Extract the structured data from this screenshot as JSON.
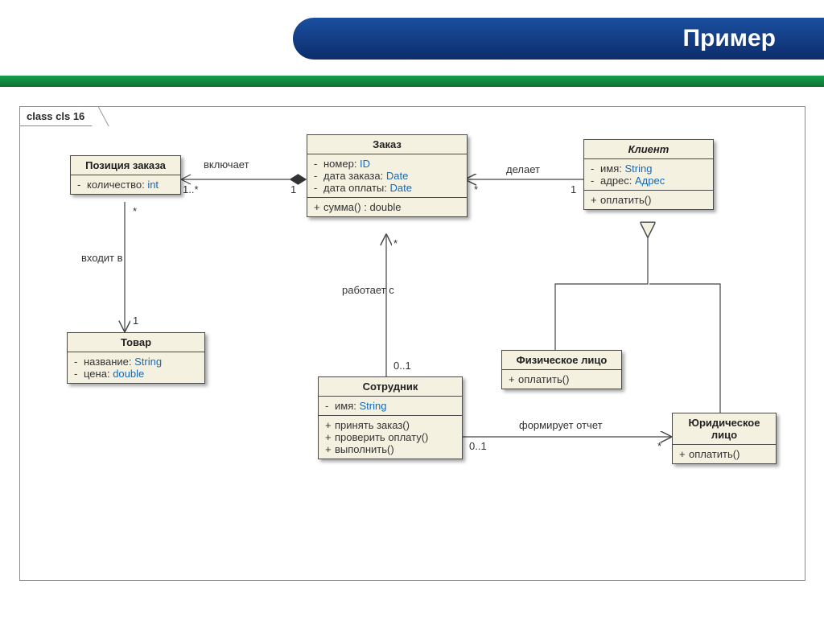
{
  "slide": {
    "title": "Пример"
  },
  "frame": {
    "label": "class cls 16"
  },
  "classes": {
    "orderItem": {
      "name": "Позиция заказа",
      "attrs": [
        {
          "vis": "-",
          "name": "количество",
          "type": "int"
        }
      ]
    },
    "order": {
      "name": "Заказ",
      "attrs": [
        {
          "vis": "-",
          "name": "номер",
          "type": "ID"
        },
        {
          "vis": "-",
          "name": "дата заказа",
          "type": "Date"
        },
        {
          "vis": "-",
          "name": "дата оплаты",
          "type": "Date"
        }
      ],
      "ops": [
        {
          "vis": "+",
          "sig": "сумма() : double"
        }
      ]
    },
    "client": {
      "name": "Клиент",
      "nameItalic": true,
      "attrs": [
        {
          "vis": "-",
          "name": "имя",
          "type": "String"
        },
        {
          "vis": "-",
          "name": "адрес",
          "type": "Адрес"
        }
      ],
      "ops": [
        {
          "vis": "+",
          "sig": "оплатить()"
        }
      ]
    },
    "product": {
      "name": "Товар",
      "attrs": [
        {
          "vis": "-",
          "name": "название",
          "type": "String"
        },
        {
          "vis": "-",
          "name": "цена",
          "type": "double"
        }
      ]
    },
    "employee": {
      "name": "Сотрудник",
      "attrs": [
        {
          "vis": "-",
          "name": "имя",
          "type": "String"
        }
      ],
      "ops": [
        {
          "vis": "+",
          "sig": "принять заказ()"
        },
        {
          "vis": "+",
          "sig": "проверить оплату()"
        },
        {
          "vis": "+",
          "sig": "выполнить()"
        }
      ]
    },
    "person": {
      "name": "Физическое лицо",
      "ops": [
        {
          "vis": "+",
          "sig": "оплатить()"
        }
      ]
    },
    "legal": {
      "name": "Юридическое лицо",
      "ops": [
        {
          "vis": "+",
          "sig": "оплатить()"
        }
      ]
    }
  },
  "relations": {
    "includes": {
      "label": "включает",
      "m1": "1..*",
      "m2": "1"
    },
    "makes": {
      "label": "делает",
      "m1": "*",
      "m2": "1"
    },
    "belongsTo": {
      "label": "входит в",
      "m1": "*",
      "m2": "1"
    },
    "worksWith": {
      "label": "работает с",
      "m1": "*",
      "m2": "0..1"
    },
    "formsReport": {
      "label": "формирует отчет",
      "m1": "0..1",
      "m2": "*"
    }
  }
}
